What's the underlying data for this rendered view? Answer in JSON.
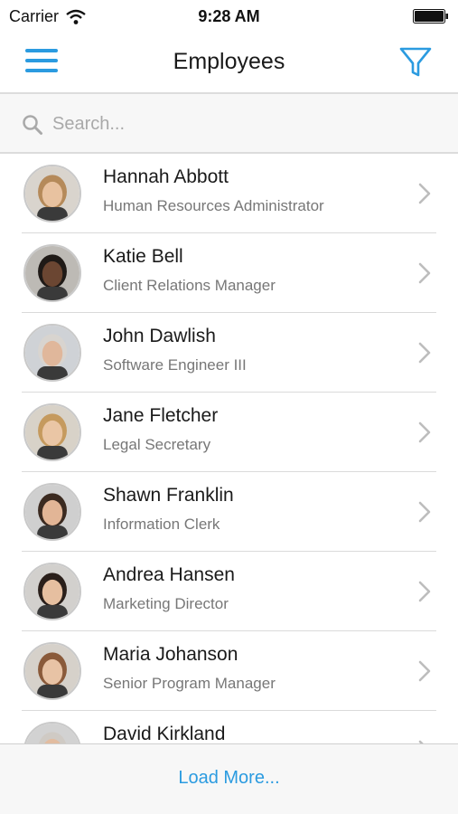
{
  "status_bar": {
    "carrier": "Carrier",
    "time": "9:28 AM"
  },
  "nav": {
    "title": "Employees",
    "menu_icon": "hamburger-menu-icon",
    "filter_icon": "filter-funnel-icon"
  },
  "search": {
    "placeholder": "Search...",
    "value": ""
  },
  "employees": [
    {
      "name": "Hannah Abbott",
      "title": "Human Resources Administrator",
      "skin": "#e8c2a0",
      "hair": "#b58a5a",
      "bg": "#d9d4cd"
    },
    {
      "name": "Katie Bell",
      "title": "Client Relations Manager",
      "skin": "#6b4632",
      "hair": "#1f1a17",
      "bg": "#bdbab5"
    },
    {
      "name": "John Dawlish",
      "title": "Software Engineer III",
      "skin": "#e0b79b",
      "hair": "#d8d4cf",
      "bg": "#cfd2d6"
    },
    {
      "name": "Jane Fletcher",
      "title": "Legal Secretary",
      "skin": "#eac6a5",
      "hair": "#c59a5e",
      "bg": "#d8d2c8"
    },
    {
      "name": "Shawn Franklin",
      "title": "Information Clerk",
      "skin": "#e2b596",
      "hair": "#3b2a20",
      "bg": "#cfcfcf"
    },
    {
      "name": "Andrea Hansen",
      "title": "Marketing Director",
      "skin": "#e6bfa0",
      "hair": "#2a1f1a",
      "bg": "#d2d0cd"
    },
    {
      "name": "Maria Johanson",
      "title": "Senior Program Manager",
      "skin": "#e8c3a5",
      "hair": "#8a5a3a",
      "bg": "#d6d1ca"
    },
    {
      "name": "David Kirkland",
      "title": "",
      "skin": "#e2bca0",
      "hair": "#cfcac4",
      "bg": "#d2d2d2"
    }
  ],
  "load_more_label": "Load More...",
  "colors": {
    "accent": "#2b9be0",
    "secondary_text": "#777777",
    "divider": "#dadada"
  }
}
